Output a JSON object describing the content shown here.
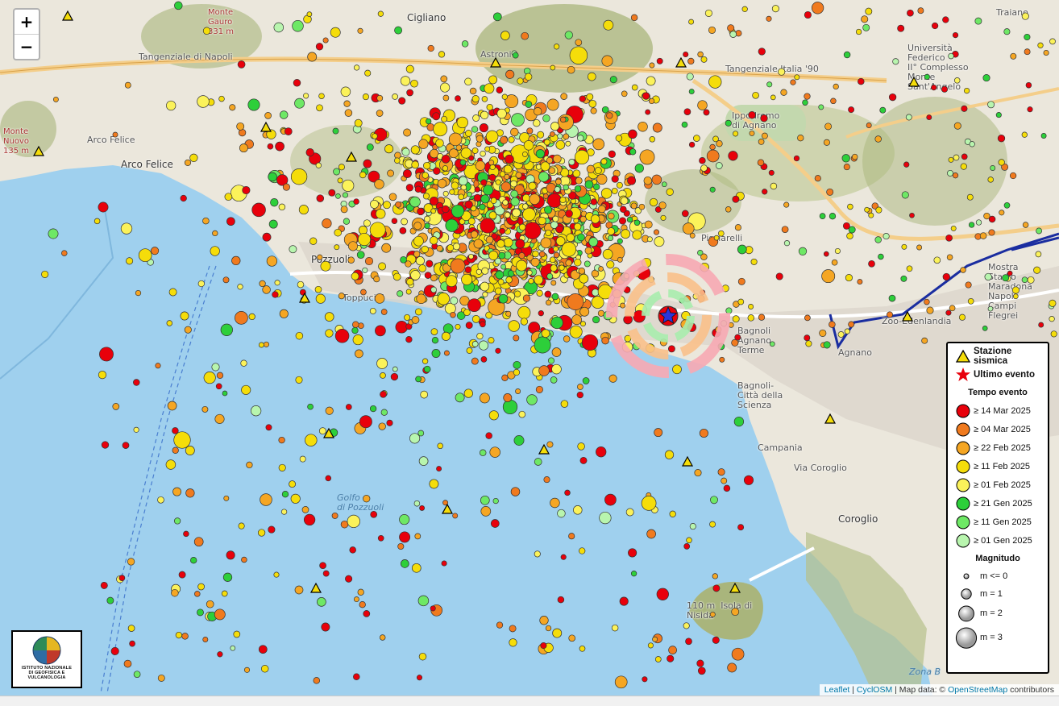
{
  "map": {
    "zoom_in_label": "+",
    "zoom_out_label": "−",
    "colors": {
      "sea": "#9fd0ee",
      "land": "#ebe7dc",
      "hill": "#a9b57c",
      "road": "#f4ce8a",
      "urban": "#dcd6cc"
    },
    "place_labels": [
      {
        "key": "cigliano",
        "text": "Cigliano",
        "cls": "big"
      },
      {
        "key": "monte_gauro",
        "text": "Monte\nGauro\n331 m",
        "cls": "peak"
      },
      {
        "key": "tangenziale1",
        "text": "Tangenziale di Napoli",
        "cls": ""
      },
      {
        "key": "tangenziale2",
        "text": "Tangenziale Italia '90",
        "cls": ""
      },
      {
        "key": "ippodromo",
        "text": "Ippodromo\ndi Agnano",
        "cls": ""
      },
      {
        "key": "arco_felice1",
        "text": "Arco Felice",
        "cls": ""
      },
      {
        "key": "arco_felice2",
        "text": "Arco Felice",
        "cls": "big"
      },
      {
        "key": "monte_nuovo",
        "text": "Monte\nNuovo\n135 m",
        "cls": "peak"
      },
      {
        "key": "pozzuoli",
        "text": "Pozzuoli",
        "cls": "big"
      },
      {
        "key": "toppucini",
        "text": "Toppucini",
        "cls": ""
      },
      {
        "key": "agnano",
        "text": "Agnano",
        "cls": ""
      },
      {
        "key": "bagnoli",
        "text": "Bagnoli\nAgnano\nTerme",
        "cls": ""
      },
      {
        "key": "citta_scienza",
        "text": "Bagnoli-\nCittà della\nScienza",
        "cls": ""
      },
      {
        "key": "golfo",
        "text": "Golfo\ndi Pozzuoli",
        "cls": "water"
      },
      {
        "key": "coroglio",
        "text": "Coroglio",
        "cls": "big"
      },
      {
        "key": "nisida",
        "text": "110 m  Isola di\nNisida",
        "cls": ""
      },
      {
        "key": "zona_b",
        "text": "Zona B",
        "cls": "water"
      },
      {
        "key": "traiano",
        "text": "Traiano",
        "cls": ""
      },
      {
        "key": "universita",
        "text": "Università\nFederico\nII° Complesso\nMonte\nSant'Angelo",
        "cls": ""
      },
      {
        "key": "stadio",
        "text": "Mostra\nStadio\nMaradona\nNapoli\nCampi\nFlegrei",
        "cls": ""
      },
      {
        "key": "zoo",
        "text": "Zoo-Edenlandia",
        "cls": ""
      },
      {
        "key": "astroni",
        "text": "Astroni",
        "cls": ""
      },
      {
        "key": "pisciarelli",
        "text": "Pisciarelli",
        "cls": ""
      },
      {
        "key": "via_coroglio",
        "text": "Via Coroglio",
        "cls": ""
      },
      {
        "key": "campania",
        "text": "Campania",
        "cls": ""
      }
    ]
  },
  "legend": {
    "station_label": "Stazione sismica",
    "last_event_label": "Ultimo evento",
    "time_title": "Tempo evento",
    "time_classes": [
      {
        "label": "≥ 14 Mar 2025",
        "color": "#e8000b"
      },
      {
        "label": "≥ 04 Mar 2025",
        "color": "#f07a1e"
      },
      {
        "label": "≥ 22 Feb 2025",
        "color": "#f5a623"
      },
      {
        "label": "≥ 11 Feb 2025",
        "color": "#f5dd0a"
      },
      {
        "label": "≥ 01 Feb 2025",
        "color": "#fbf25a"
      },
      {
        "label": "≥ 21 Gen 2025",
        "color": "#2dcf3a"
      },
      {
        "label": "≥ 11 Gen 2025",
        "color": "#6ee865"
      },
      {
        "label": "≥ 01 Gen 2025",
        "color": "#b8f5ae"
      }
    ],
    "mag_title": "Magnitudo",
    "mag_classes": [
      {
        "label": "m <= 0",
        "m": 0
      },
      {
        "label": "m = 1",
        "m": 1
      },
      {
        "label": "m = 2",
        "m": 2
      },
      {
        "label": "m = 3",
        "m": 3
      }
    ]
  },
  "attribution": {
    "leaflet": "Leaflet",
    "sep": " | ",
    "cyclosm": "CyclOSM",
    "mapdata": " | Map data: © ",
    "osm": "OpenStreetMap",
    "contrib": " contributors"
  },
  "logo": {
    "line1": "ISTITUTO NAZIONALE",
    "line2": "DI GEOFISICA E VULCANOLOGIA"
  }
}
